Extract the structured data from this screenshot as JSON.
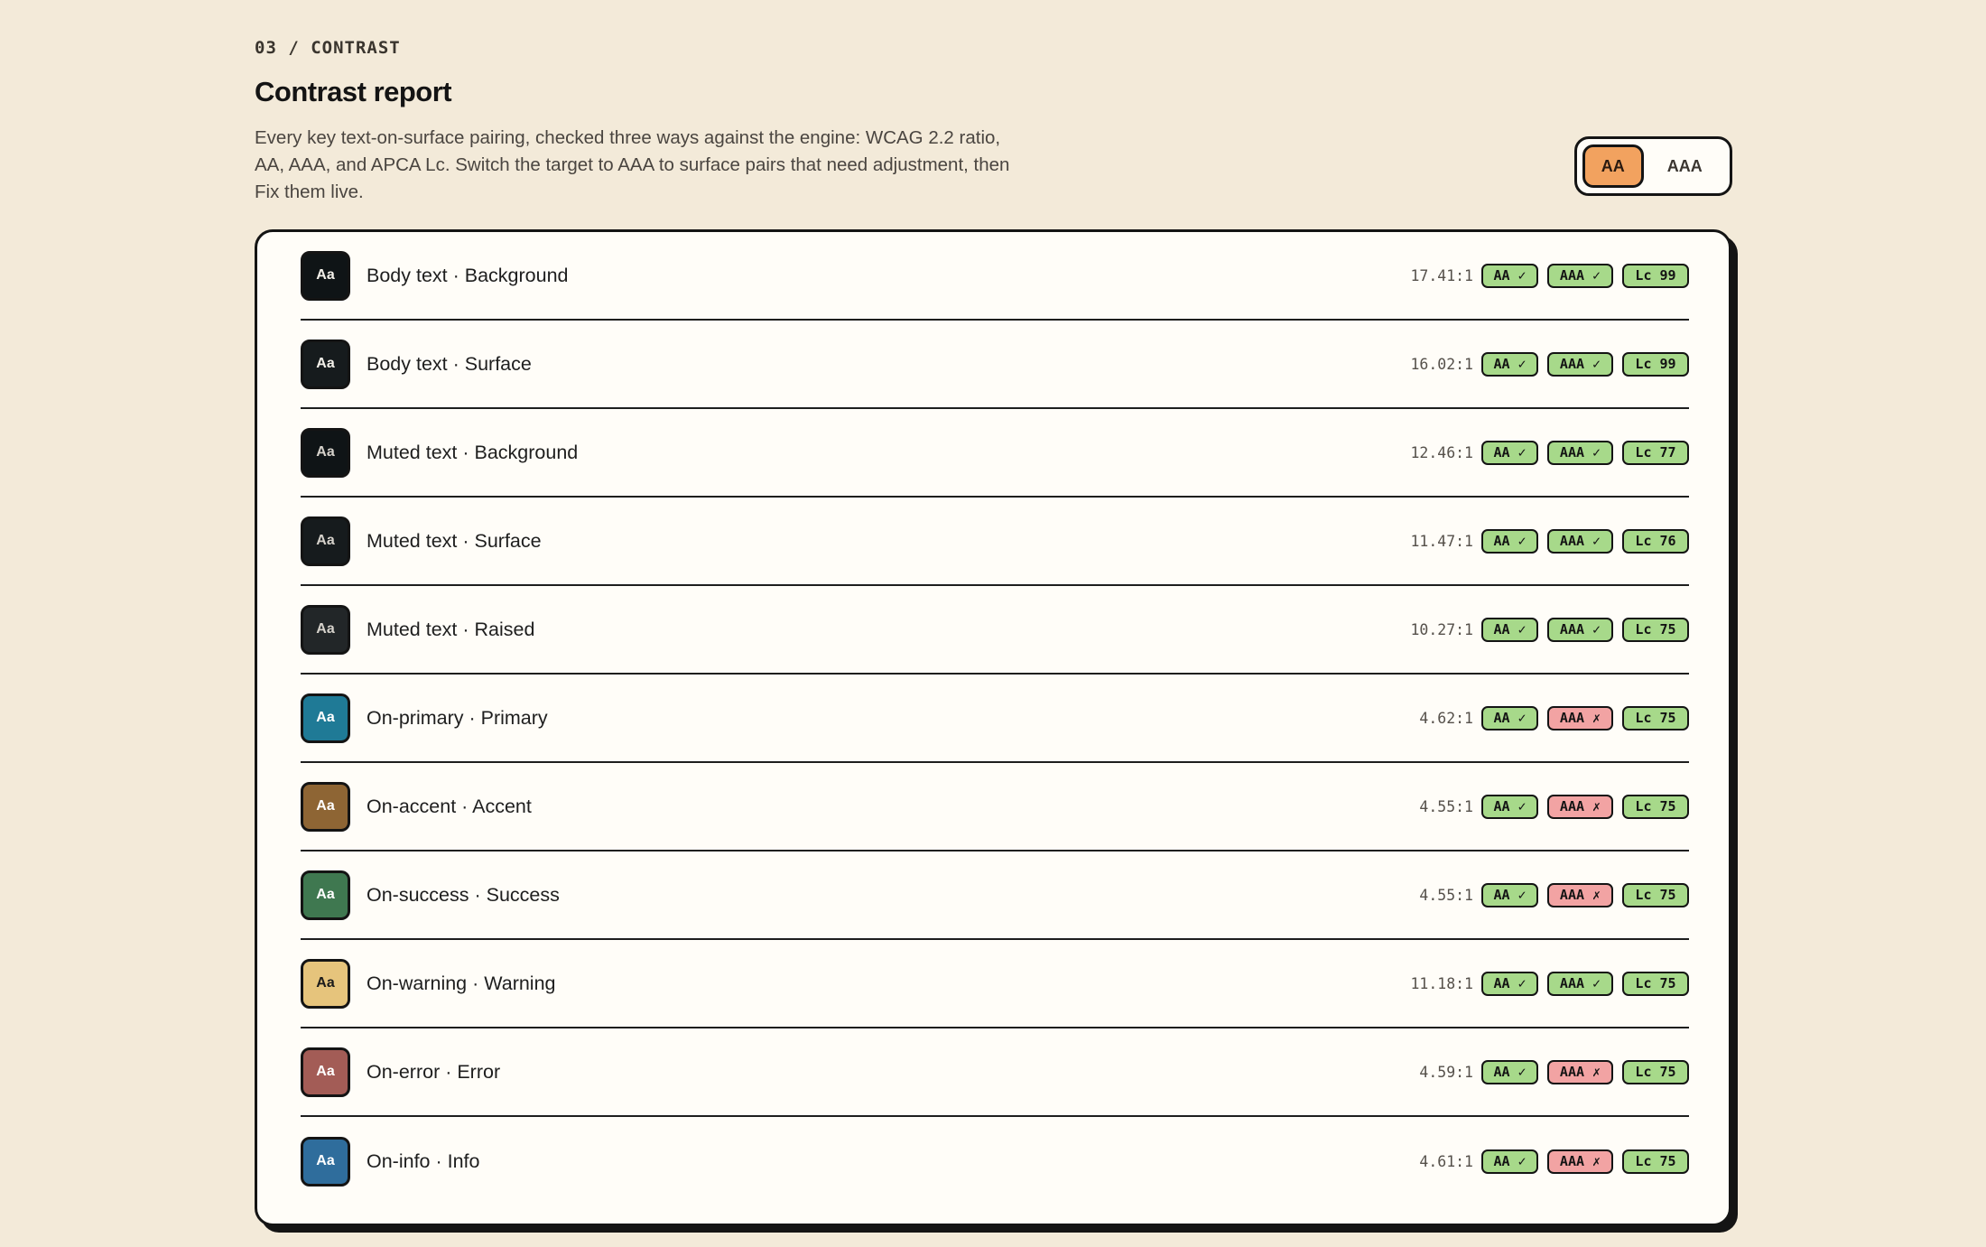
{
  "header": {
    "eyebrow": "03 / CONTRAST",
    "title": "Contrast report",
    "description": "Every key text-on-surface pairing, checked three ways against the engine: WCAG 2.2 ratio, AA, AAA, and APCA Lc. Switch the target to AAA to surface pairs that need adjustment, then Fix them live."
  },
  "toggle": {
    "options": [
      "AA",
      "AAA"
    ],
    "selected": "AA",
    "active_color": "#f2a25f"
  },
  "swatch_label": "Aa",
  "rows": [
    {
      "label": "Body text · Background",
      "ratio": "17.41:1",
      "aa": "AA ✓",
      "aaa": "AAA ✓",
      "aaa_pass": true,
      "lc": "Lc 99",
      "bg": "#0f1416",
      "fg": "#f4f1ea"
    },
    {
      "label": "Body text · Surface",
      "ratio": "16.02:1",
      "aa": "AA ✓",
      "aaa": "AAA ✓",
      "aaa_pass": true,
      "lc": "Lc 99",
      "bg": "#161b1d",
      "fg": "#f4f1ea"
    },
    {
      "label": "Muted text · Background",
      "ratio": "12.46:1",
      "aa": "AA ✓",
      "aaa": "AAA ✓",
      "aaa_pass": true,
      "lc": "Lc 77",
      "bg": "#0f1416",
      "fg": "#d6d2cb"
    },
    {
      "label": "Muted text · Surface",
      "ratio": "11.47:1",
      "aa": "AA ✓",
      "aaa": "AAA ✓",
      "aaa_pass": true,
      "lc": "Lc 76",
      "bg": "#161b1d",
      "fg": "#d6d2cb"
    },
    {
      "label": "Muted text · Raised",
      "ratio": "10.27:1",
      "aa": "AA ✓",
      "aaa": "AAA ✓",
      "aaa_pass": true,
      "lc": "Lc 75",
      "bg": "#222628",
      "fg": "#d6d2cb"
    },
    {
      "label": "On-primary · Primary",
      "ratio": "4.62:1",
      "aa": "AA ✓",
      "aaa": "AAA ✗",
      "aaa_pass": false,
      "lc": "Lc 75",
      "bg": "#1f7a96",
      "fg": "#ffffff"
    },
    {
      "label": "On-accent · Accent",
      "ratio": "4.55:1",
      "aa": "AA ✓",
      "aaa": "AAA ✗",
      "aaa_pass": false,
      "lc": "Lc 75",
      "bg": "#8e6534",
      "fg": "#ffffff"
    },
    {
      "label": "On-success · Success",
      "ratio": "4.55:1",
      "aa": "AA ✓",
      "aaa": "AAA ✗",
      "aaa_pass": false,
      "lc": "Lc 75",
      "bg": "#3f7850",
      "fg": "#ffffff"
    },
    {
      "label": "On-warning · Warning",
      "ratio": "11.18:1",
      "aa": "AA ✓",
      "aaa": "AAA ✓",
      "aaa_pass": true,
      "lc": "Lc 75",
      "bg": "#e6c47c",
      "fg": "#1a1a1a"
    },
    {
      "label": "On-error · Error",
      "ratio": "4.59:1",
      "aa": "AA ✓",
      "aaa": "AAA ✗",
      "aaa_pass": false,
      "lc": "Lc 75",
      "bg": "#a35c56",
      "fg": "#ffffff"
    },
    {
      "label": "On-info · Info",
      "ratio": "4.61:1",
      "aa": "AA ✓",
      "aaa": "AAA ✗",
      "aaa_pass": false,
      "lc": "Lc 75",
      "bg": "#2f6d9c",
      "fg": "#ffffff"
    }
  ]
}
